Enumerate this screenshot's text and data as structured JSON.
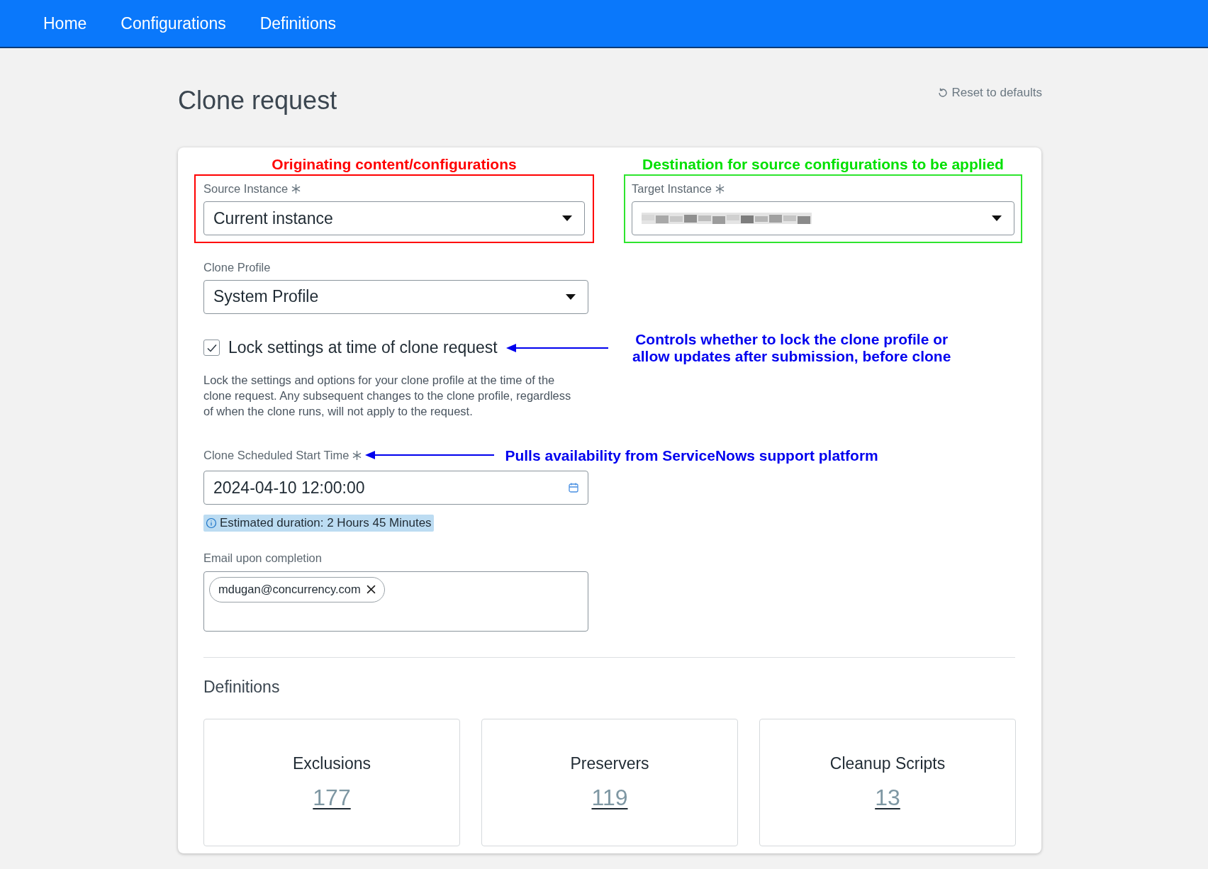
{
  "nav": [
    {
      "label": "Home"
    },
    {
      "label": "Configurations"
    },
    {
      "label": "Definitions"
    }
  ],
  "page": {
    "title": "Clone request",
    "reset_link": "Reset to defaults"
  },
  "source_instance": {
    "label": "Source Instance",
    "required": true,
    "value": "Current instance",
    "callout": "Originating content/configurations"
  },
  "target_instance": {
    "label": "Target Instance",
    "required": true,
    "value_redacted": true,
    "callout": "Destination for source configurations to be applied"
  },
  "clone_profile": {
    "label": "Clone Profile",
    "value": "System Profile"
  },
  "lock_settings": {
    "label": "Lock settings at time of clone request",
    "checked": true,
    "help": "Lock the settings and options for your clone profile at the time of the clone request. Any subsequent changes to the clone profile, regardless of when the clone runs, will not apply to the request.",
    "callout": "Controls whether to lock the clone profile or allow updates after submission, before clone"
  },
  "start_time": {
    "label": "Clone Scheduled Start Time",
    "required": true,
    "value": "2024-04-10 12:00:00",
    "callout": "Pulls availability from ServiceNows support platform",
    "estimate": "Estimated duration: 2 Hours 45 Minutes"
  },
  "email": {
    "label": "Email upon completion",
    "chips": [
      "mdugan@concurrency.com"
    ]
  },
  "definitions": {
    "title": "Definitions",
    "cards": [
      {
        "label": "Exclusions",
        "count": "177"
      },
      {
        "label": "Preservers",
        "count": "119"
      },
      {
        "label": "Cleanup Scripts",
        "count": "13"
      }
    ]
  }
}
